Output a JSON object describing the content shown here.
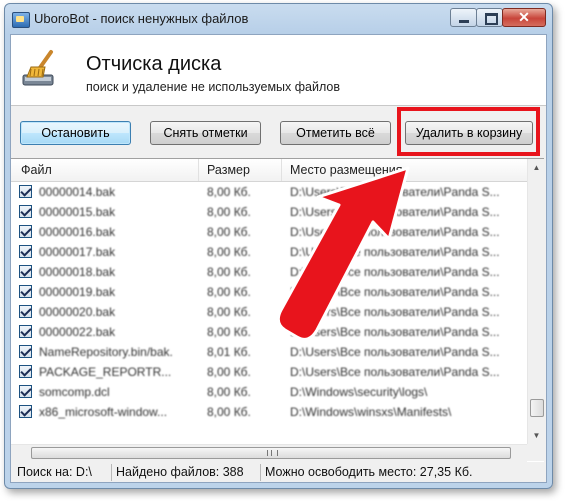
{
  "window": {
    "title": "UboroBot - поиск ненужных файлов",
    "close_label": "✕"
  },
  "header": {
    "title": "Отчиска диска",
    "subtitle": "поиск и удаление не используемых файлов"
  },
  "toolbar": {
    "stop_label": "Остановить",
    "uncheck_label": "Снять отметки",
    "check_all_label": "Отметить всё",
    "delete_label": "Удалить в корзину"
  },
  "grid": {
    "columns": [
      "Файл",
      "Размер",
      "Место размещения"
    ],
    "rows": [
      {
        "name": "00000014.bak",
        "size": "8,00 Кб.",
        "path": "D:\\Users\\Все пользователи\\Panda S..."
      },
      {
        "name": "00000015.bak",
        "size": "8,00 Кб.",
        "path": "D:\\Users\\Все пользователи\\Panda S..."
      },
      {
        "name": "00000016.bak",
        "size": "8,00 Кб.",
        "path": "D:\\Users\\Все пользователи\\Panda S..."
      },
      {
        "name": "00000017.bak",
        "size": "8,00 Кб.",
        "path": "D:\\Users\\Все пользователи\\Panda S..."
      },
      {
        "name": "00000018.bak",
        "size": "8,00 Кб.",
        "path": "D:\\Users\\Все пользователи\\Panda S..."
      },
      {
        "name": "00000019.bak",
        "size": "8,00 Кб.",
        "path": "D:\\Users\\Все пользователи\\Panda S..."
      },
      {
        "name": "00000020.bak",
        "size": "8,00 Кб.",
        "path": "D:\\Users\\Все пользователи\\Panda S..."
      },
      {
        "name": "00000022.bak",
        "size": "8,00 Кб.",
        "path": "D:\\Users\\Все пользователи\\Panda S..."
      },
      {
        "name": "NameRepository.bin/bak.",
        "size": "8,01 Кб.",
        "path": "D:\\Users\\Все пользователи\\Panda S..."
      },
      {
        "name": "PACKAGE_REPORTR...",
        "size": "8,00 Кб.",
        "path": "D:\\Users\\Все пользователи\\Panda S..."
      },
      {
        "name": "somcomp.dcl",
        "size": "8,00 Кб.",
        "path": "D:\\Windows\\security\\logs\\"
      },
      {
        "name": "x86_microsoft-window...",
        "size": "8,00 Кб.",
        "path": "D:\\Windows\\winsxs\\Manifests\\"
      }
    ]
  },
  "status": {
    "search_on": "Поиск на: D:\\",
    "found": "Найдено файлов: 388",
    "free": "Можно освободить место: 27,35 Кб."
  },
  "colors": {
    "highlight": "#e8141c",
    "arrow": "#e8141c"
  }
}
